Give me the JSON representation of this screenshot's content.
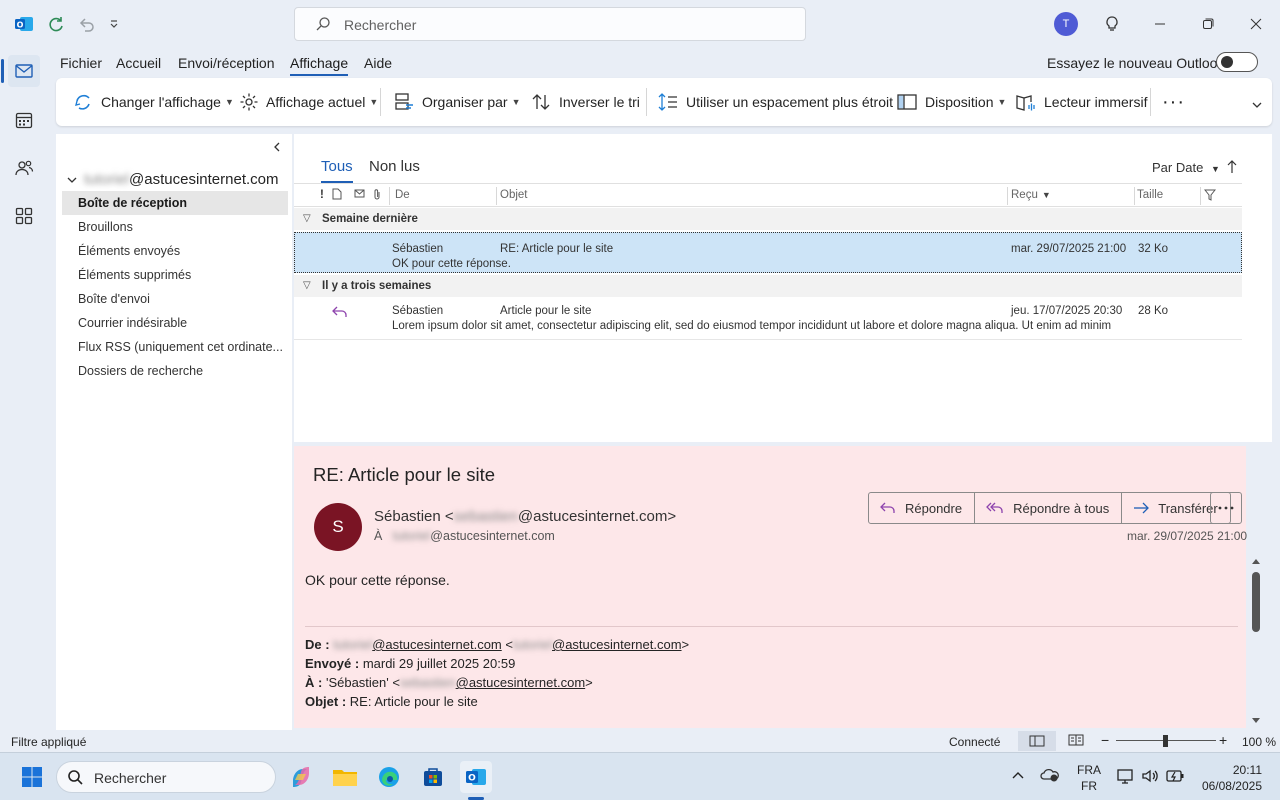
{
  "window": {
    "search_placeholder": "Rechercher",
    "avatar_initial": "T"
  },
  "menu": {
    "items": [
      "Fichier",
      "Accueil",
      "Envoi/réception",
      "Affichage",
      "Aide"
    ],
    "active": "Affichage",
    "new_outlook_label": "Essayez le nouveau Outlook"
  },
  "ribbon": {
    "change_view": "Changer l'affichage",
    "current_view": "Affichage actuel",
    "arrange_by": "Organiser par",
    "reverse_sort": "Inverser le tri",
    "narrow_spacing": "Utiliser un espacement plus étroit",
    "layout": "Disposition",
    "immersive_reader": "Lecteur immersif"
  },
  "folders": {
    "account_blurred": "tutoriel",
    "account_domain": "@astucesinternet.com",
    "items": [
      {
        "label": "Boîte de réception",
        "selected": true
      },
      {
        "label": "Brouillons"
      },
      {
        "label": "Éléments envoyés"
      },
      {
        "label": "Éléments supprimés"
      },
      {
        "label": "Boîte d'envoi"
      },
      {
        "label": "Courrier indésirable"
      },
      {
        "label": "Flux RSS (uniquement cet ordinate..."
      },
      {
        "label": "Dossiers de recherche"
      }
    ]
  },
  "list": {
    "tabs": [
      "Tous",
      "Non lus"
    ],
    "sort_label": "Par Date",
    "columns": {
      "from": "De",
      "subject": "Objet",
      "received": "Reçu",
      "size": "Taille"
    },
    "groups": [
      {
        "label": "Semaine dernière",
        "messages": [
          {
            "from": "Sébastien",
            "subject": "RE: Article pour le site",
            "preview": "OK pour cette réponse.",
            "date": "mar. 29/07/2025 21:00",
            "size": "32 Ko"
          }
        ]
      },
      {
        "label": "Il y a trois semaines",
        "messages": [
          {
            "from": "Sébastien",
            "subject": "Article pour le site",
            "preview": "Lorem ipsum dolor sit amet, consectetur adipiscing elit, sed do eiusmod tempor incididunt ut labore et dolore magna aliqua. Ut enim ad minim",
            "date": "jeu. 17/07/2025 20:30",
            "size": "28 Ko"
          }
        ]
      }
    ]
  },
  "reading": {
    "subject": "RE: Article pour le site",
    "avatar_initial": "S",
    "sender_name": "Sébastien <",
    "sender_blurred": "sebastien",
    "sender_domain": "@astucesinternet.com>",
    "to_prefix": "À",
    "to_blurred": "tutoriel",
    "to_domain": "@astucesinternet.com",
    "reply": "Répondre",
    "reply_all": "Répondre à tous",
    "forward": "Transférer",
    "date": "mar. 29/07/2025 21:00",
    "body": "OK pour cette réponse.",
    "quoted": {
      "from_label": "De :",
      "from_blurred": "tutoriel",
      "from_domain": "@astucesinternet.com",
      "from_blurred2": "tutoriel",
      "from_domain2": "@astucesinternet.com",
      "sent_label": "Envoyé :",
      "sent_value": "mardi 29 juillet 2025 20:59",
      "to_label": "À :",
      "to_name": "'Sébastien' <",
      "to_blurred": "sebastien",
      "to_domain": "@astucesinternet.com",
      "subject_label": "Objet :",
      "subject_value": "RE: Article pour le site"
    }
  },
  "status": {
    "filter": "Filtre appliqué",
    "connection": "Connecté",
    "zoom": "100 %"
  },
  "taskbar": {
    "search_placeholder": "Rechercher",
    "lang_line1": "FRA",
    "lang_line2": "FR",
    "time": "20:11",
    "date": "06/08/2025"
  },
  "colors": {
    "accent": "#1f5fb6",
    "selected_row": "#cde4f7",
    "reading_bg": "#fde7e9",
    "sender_avatar": "#7a1424",
    "user_avatar": "#4f5bd5"
  }
}
